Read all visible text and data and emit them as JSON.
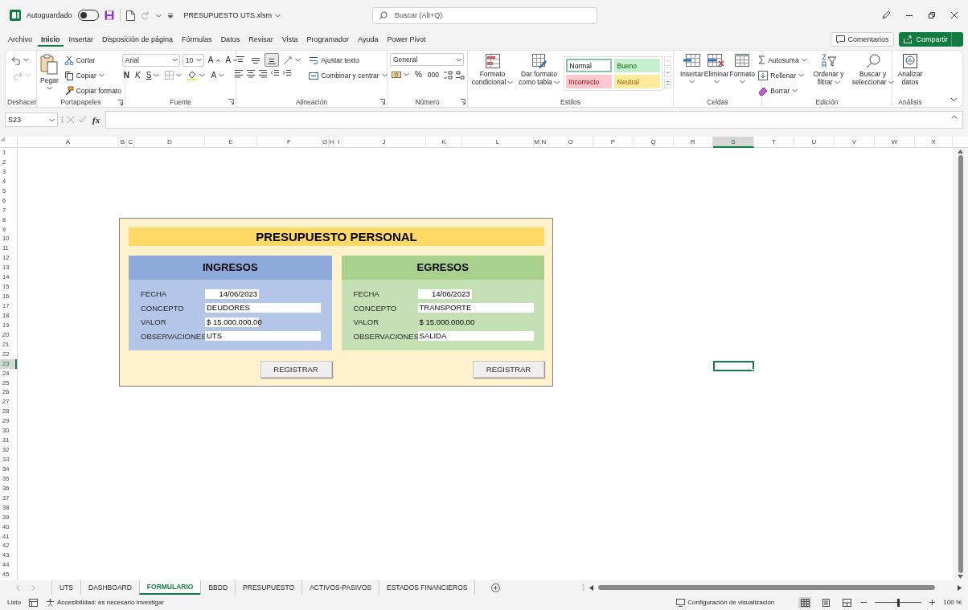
{
  "title_bar": {
    "autosave_label": "Autoguardado",
    "autosave_on": false,
    "file_name": "PRESUPUESTO UTS.xlsm",
    "search_placeholder": "Buscar (Alt+Q)"
  },
  "menu_tabs": [
    {
      "label": "Archivo",
      "selected": false
    },
    {
      "label": "Inicio",
      "selected": true
    },
    {
      "label": "Insertar",
      "selected": false
    },
    {
      "label": "Disposición de página",
      "selected": false
    },
    {
      "label": "Fórmulas",
      "selected": false
    },
    {
      "label": "Datos",
      "selected": false
    },
    {
      "label": "Revisar",
      "selected": false
    },
    {
      "label": "Vista",
      "selected": false
    },
    {
      "label": "Programador",
      "selected": false
    },
    {
      "label": "Ayuda",
      "selected": false
    },
    {
      "label": "Power Pivot",
      "selected": false
    }
  ],
  "comments_button": "Comentarios",
  "share_button": "Compartir",
  "ribbon_groups": [
    {
      "kind": "undo",
      "label": "Deshacer",
      "undo_disabled": false,
      "redo_disabled": true
    },
    {
      "kind": "clipboard",
      "label": "Portapapeles",
      "paste": "Pegar",
      "cut": "Cortar",
      "copy": "Copiar",
      "format_painter": "Copiar formato"
    },
    {
      "kind": "font",
      "label": "Fuente",
      "font_name": "Arial",
      "font_size": "10",
      "grow": "A",
      "shrink": "A",
      "bold": "N",
      "italic": "K",
      "underline": "S",
      "font_color": "A"
    },
    {
      "kind": "alignment",
      "label": "Alineación",
      "vertical_align": [
        {
          "selected": false
        },
        {
          "selected": false
        },
        {
          "selected": true
        }
      ],
      "wrap_text": "Ajustar texto",
      "merge_center": "Combinar y centrar"
    },
    {
      "kind": "number",
      "label": "Número",
      "format": "General",
      "percent": "%",
      "thousands": "000"
    },
    {
      "kind": "styles",
      "label": "Estilos",
      "conditional": "Formato condicional",
      "as_table": "Dar formato como tabla",
      "styles": [
        {
          "kind": "normal",
          "label": "Normal",
          "selected": true
        },
        {
          "kind": "good",
          "label": "Bueno",
          "selected": false
        },
        {
          "kind": "bad",
          "label": "Incorrecto",
          "selected": false
        },
        {
          "kind": "neutral",
          "label": "Neutral",
          "selected": false
        }
      ]
    },
    {
      "kind": "cells",
      "label": "Celdas",
      "buttons": [
        "Insertar",
        "Eliminar",
        "Formato"
      ]
    },
    {
      "kind": "editing",
      "label": "Edición",
      "autosum": "Autosuma",
      "fill": "Rellenar",
      "clear": "Borrar",
      "sort": "Ordenar y filtrar",
      "find": "Buscar y seleccionar"
    },
    {
      "kind": "analysis",
      "label": "Análisis",
      "analyze": "Analizar datos"
    }
  ],
  "name_box": "S23",
  "insert_function": "fx",
  "columns": [
    {
      "label": "A",
      "selected": false
    },
    {
      "label": "B",
      "selected": false
    },
    {
      "label": "C",
      "selected": false
    },
    {
      "label": "D",
      "selected": false
    },
    {
      "label": "E",
      "selected": false
    },
    {
      "label": "F",
      "selected": false
    },
    {
      "label": "G",
      "selected": false
    },
    {
      "label": "H",
      "selected": false
    },
    {
      "label": "I",
      "selected": false
    },
    {
      "label": "J",
      "selected": false
    },
    {
      "label": "K",
      "selected": false
    },
    {
      "label": "L",
      "selected": false
    },
    {
      "label": "M",
      "selected": false
    },
    {
      "label": "N",
      "selected": false
    },
    {
      "label": "O",
      "selected": false
    },
    {
      "label": "P",
      "selected": false
    },
    {
      "label": "Q",
      "selected": false
    },
    {
      "label": "R",
      "selected": false
    },
    {
      "label": "S",
      "selected": true
    },
    {
      "label": "T",
      "selected": false
    },
    {
      "label": "U",
      "selected": false
    },
    {
      "label": "V",
      "selected": false
    },
    {
      "label": "W",
      "selected": false
    },
    {
      "label": "X",
      "selected": false
    }
  ],
  "rows": [
    {
      "label": "1",
      "selected": false
    },
    {
      "label": "2",
      "selected": false
    },
    {
      "label": "3",
      "selected": false
    },
    {
      "label": "4",
      "selected": false
    },
    {
      "label": "5",
      "selected": false
    },
    {
      "label": "6",
      "selected": false
    },
    {
      "label": "7",
      "selected": false
    },
    {
      "label": "8",
      "selected": false
    },
    {
      "label": "9",
      "selected": false
    },
    {
      "label": "10",
      "selected": false
    },
    {
      "label": "11",
      "selected": false
    },
    {
      "label": "12",
      "selected": false
    },
    {
      "label": "13",
      "selected": false
    },
    {
      "label": "14",
      "selected": false
    },
    {
      "label": "15",
      "selected": false
    },
    {
      "label": "16",
      "selected": false
    },
    {
      "label": "17",
      "selected": false
    },
    {
      "label": "18",
      "selected": false
    },
    {
      "label": "19",
      "selected": false
    },
    {
      "label": "20",
      "selected": false
    },
    {
      "label": "21",
      "selected": false
    },
    {
      "label": "22",
      "selected": false
    },
    {
      "label": "23",
      "selected": true
    },
    {
      "label": "24",
      "selected": false
    },
    {
      "label": "25",
      "selected": false
    },
    {
      "label": "26",
      "selected": false
    },
    {
      "label": "27",
      "selected": false
    },
    {
      "label": "28",
      "selected": false
    },
    {
      "label": "29",
      "selected": false
    },
    {
      "label": "30",
      "selected": false
    },
    {
      "label": "31",
      "selected": false
    },
    {
      "label": "32",
      "selected": false
    },
    {
      "label": "33",
      "selected": false
    },
    {
      "label": "34",
      "selected": false
    },
    {
      "label": "35",
      "selected": false
    },
    {
      "label": "36",
      "selected": false
    },
    {
      "label": "37",
      "selected": false
    },
    {
      "label": "38",
      "selected": false
    },
    {
      "label": "39",
      "selected": false
    },
    {
      "label": "40",
      "selected": false
    },
    {
      "label": "41",
      "selected": false
    },
    {
      "label": "42",
      "selected": false
    },
    {
      "label": "43",
      "selected": false
    },
    {
      "label": "44",
      "selected": false
    },
    {
      "label": "45",
      "selected": false
    }
  ],
  "form": {
    "title": "PRESUPUESTO PERSONAL",
    "panels": [
      {
        "kind": "income",
        "title": "INGRESOS",
        "button": "REGISTRAR",
        "fields": [
          {
            "kind": "date",
            "label": "FECHA",
            "value": "14/06/2023"
          },
          {
            "kind": "text",
            "label": "CONCEPTO",
            "value": "DEUDORES"
          },
          {
            "kind": "money",
            "label": "VALOR",
            "value": "$  15.000.000,00"
          },
          {
            "kind": "text",
            "label": "OBSERVACIONES",
            "value": "UTS"
          }
        ]
      },
      {
        "kind": "expense",
        "title": "EGRESOS",
        "button": "REGISTRAR",
        "fields": [
          {
            "kind": "date",
            "label": "FECHA",
            "value": "14/06/2023"
          },
          {
            "kind": "text",
            "label": "CONCEPTO",
            "value": "TRANSPORTE"
          },
          {
            "kind": "plain",
            "label": "VALOR",
            "value": "$  15.000.000,00"
          },
          {
            "kind": "text",
            "label": "OBSERVACIONES",
            "value": "SALIDA"
          }
        ]
      }
    ]
  },
  "sheet_tabs": [
    {
      "label": "UTS",
      "selected": false
    },
    {
      "label": "DASHBOARD",
      "selected": false
    },
    {
      "label": "FORMULARIO",
      "selected": true
    },
    {
      "label": "BBDD",
      "selected": false
    },
    {
      "label": "PRESUPUESTO",
      "selected": false
    },
    {
      "label": "ACTIVOS-PASIVOS",
      "selected": false
    },
    {
      "label": "ESTADOS FINANCIEROS",
      "selected": false
    }
  ],
  "status_bar": {
    "ready": "Listo",
    "accessibility": "Accesibilidad: es necesario investigar",
    "display_settings": "Configuración de visualización",
    "views": [
      {
        "selected": true
      },
      {
        "selected": false
      },
      {
        "selected": false
      }
    ],
    "zoom_slider": {
      "level": 0.5
    },
    "zoom": "100 %"
  }
}
